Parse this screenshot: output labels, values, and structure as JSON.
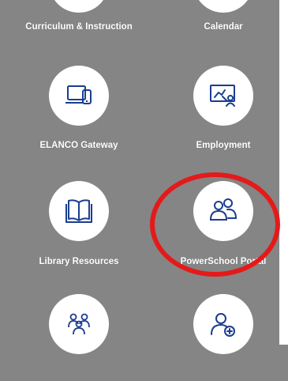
{
  "accent_color": "#1a3d8f",
  "annotation_color": "#e41a1a",
  "tiles": [
    {
      "label": "Curriculum & Instruction",
      "icon": "curriculum-icon"
    },
    {
      "label": "Calendar",
      "icon": "calendar-icon"
    },
    {
      "label": "ELANCO Gateway",
      "icon": "devices-icon"
    },
    {
      "label": "Employment",
      "icon": "presentation-icon"
    },
    {
      "label": "Library Resources",
      "icon": "open-book-icon"
    },
    {
      "label": "PowerSchool Portal",
      "icon": "users-icon"
    },
    {
      "label": "",
      "icon": "group-icon"
    },
    {
      "label": "",
      "icon": "add-user-icon"
    }
  ]
}
